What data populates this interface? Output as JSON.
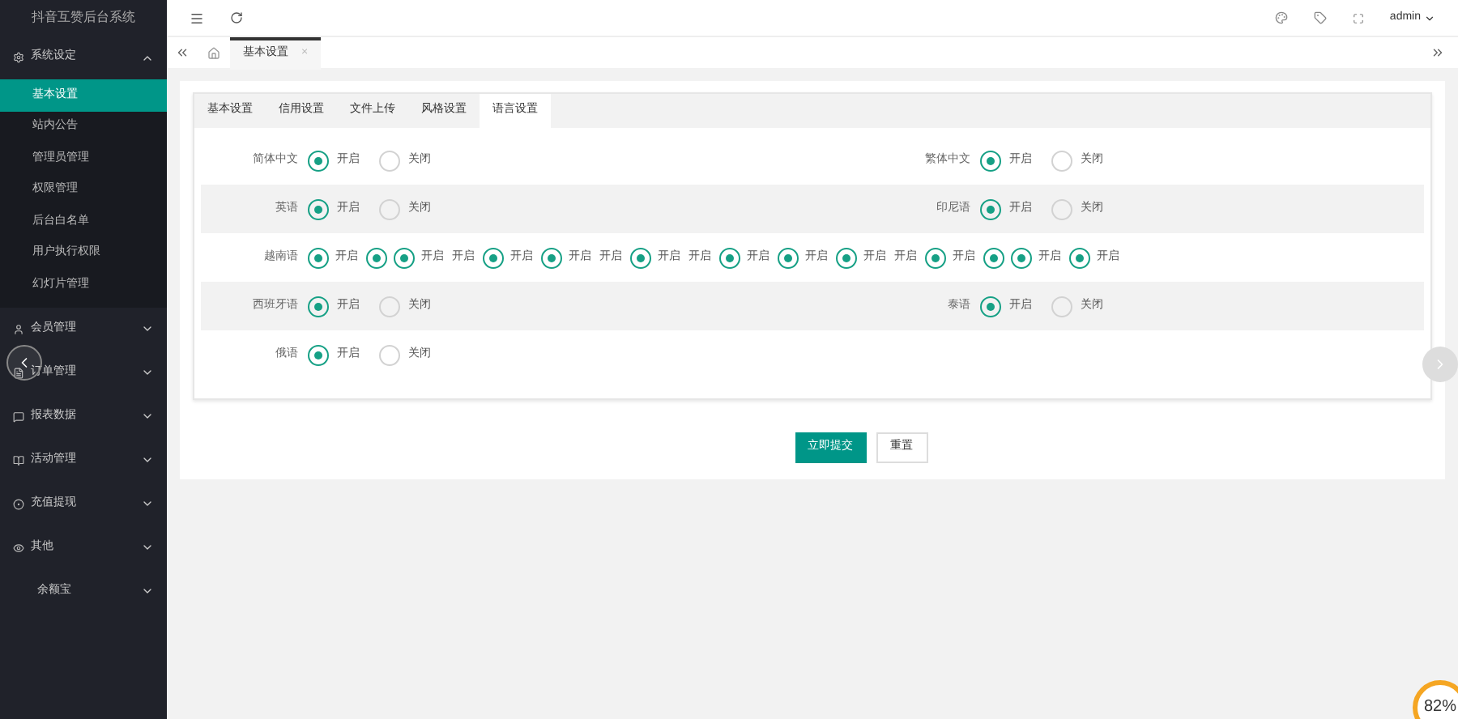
{
  "sidebar": {
    "title": "抖音互赞后台系统",
    "items": [
      {
        "label": "系统设定",
        "expanded": true,
        "children": [
          {
            "label": "基本设置",
            "selected": true
          },
          {
            "label": "站内公告",
            "selected": false
          },
          {
            "label": "管理员管理",
            "selected": false
          },
          {
            "label": "权限管理",
            "selected": false
          },
          {
            "label": "后台白名单",
            "selected": false
          },
          {
            "label": "用户执行权限",
            "selected": false
          },
          {
            "label": "幻灯片管理",
            "selected": false
          }
        ]
      },
      {
        "label": "会员管理",
        "expanded": false
      },
      {
        "label": "订单管理",
        "expanded": false
      },
      {
        "label": "报表数据",
        "expanded": false
      },
      {
        "label": "活动管理",
        "expanded": false
      },
      {
        "label": "充值提现",
        "expanded": false
      },
      {
        "label": "其他",
        "expanded": false
      },
      {
        "label": "余额宝",
        "expanded": false
      }
    ]
  },
  "header": {
    "user": "admin"
  },
  "page_tabs": [
    {
      "label": "基本设置",
      "close": "×",
      "selected": true
    }
  ],
  "form_tabs": [
    {
      "label": "基本设置",
      "selected": false
    },
    {
      "label": "信用设置",
      "selected": false
    },
    {
      "label": "文件上传",
      "selected": false
    },
    {
      "label": "风格设置",
      "selected": false
    },
    {
      "label": "语言设置",
      "selected": true
    }
  ],
  "rows": [
    {
      "kind": "pair",
      "fields": [
        {
          "label": "简体中文",
          "options": [
            {
              "text": "开启",
              "selected": true
            },
            {
              "text": "关闭",
              "selected": false
            }
          ]
        },
        {
          "label": "繁体中文",
          "options": [
            {
              "text": "开启",
              "selected": true
            },
            {
              "text": "关闭",
              "selected": false
            }
          ]
        }
      ]
    },
    {
      "kind": "pair",
      "fields": [
        {
          "label": "英语",
          "options": [
            {
              "text": "开启",
              "selected": true
            },
            {
              "text": "关闭",
              "selected": false
            }
          ]
        },
        {
          "label": "印尼语",
          "options": [
            {
              "text": "开启",
              "selected": true
            },
            {
              "text": "关闭",
              "selected": false
            }
          ]
        }
      ]
    },
    {
      "kind": "sequence",
      "label": "越南语",
      "items": [
        {
          "kind": "radio",
          "selected": true
        },
        {
          "kind": "text",
          "text": "开启"
        },
        {
          "kind": "radio",
          "selected": true
        },
        {
          "kind": "radio",
          "selected": true
        },
        {
          "kind": "text",
          "text": "开启"
        },
        {
          "kind": "text",
          "text": "开启"
        },
        {
          "kind": "radio",
          "selected": true
        },
        {
          "kind": "text",
          "text": "开启"
        },
        {
          "kind": "radio",
          "selected": true
        },
        {
          "kind": "text",
          "text": "开启"
        },
        {
          "kind": "text",
          "text": "开启"
        },
        {
          "kind": "radio",
          "selected": true
        },
        {
          "kind": "text",
          "text": "开启"
        },
        {
          "kind": "text",
          "text": "开启"
        },
        {
          "kind": "radio",
          "selected": true
        },
        {
          "kind": "text",
          "text": "开启"
        },
        {
          "kind": "radio",
          "selected": true
        },
        {
          "kind": "text",
          "text": "开启"
        },
        {
          "kind": "radio",
          "selected": true
        },
        {
          "kind": "text",
          "text": "开启"
        },
        {
          "kind": "text",
          "text": "开启"
        },
        {
          "kind": "radio",
          "selected": true
        },
        {
          "kind": "text",
          "text": "开启"
        },
        {
          "kind": "radio",
          "selected": true
        },
        {
          "kind": "radio",
          "selected": true
        },
        {
          "kind": "text",
          "text": "开启"
        },
        {
          "kind": "radio",
          "selected": true
        },
        {
          "kind": "text",
          "text": "开启"
        }
      ]
    },
    {
      "kind": "pair",
      "fields": [
        {
          "label": "西班牙语",
          "options": [
            {
              "text": "开启",
              "selected": true
            },
            {
              "text": "关闭",
              "selected": false
            }
          ]
        },
        {
          "label": "泰语",
          "options": [
            {
              "text": "开启",
              "selected": true
            },
            {
              "text": "关闭",
              "selected": false
            }
          ]
        }
      ]
    },
    {
      "kind": "pair",
      "fields": [
        {
          "label": "俄语",
          "options": [
            {
              "text": "开启",
              "selected": true
            },
            {
              "text": "关闭",
              "selected": false
            }
          ]
        }
      ]
    }
  ],
  "buttons": [
    {
      "label": "立即提交",
      "kind": "primary"
    },
    {
      "label": "重置",
      "kind": "default"
    }
  ],
  "badge": {
    "text": "82%"
  }
}
